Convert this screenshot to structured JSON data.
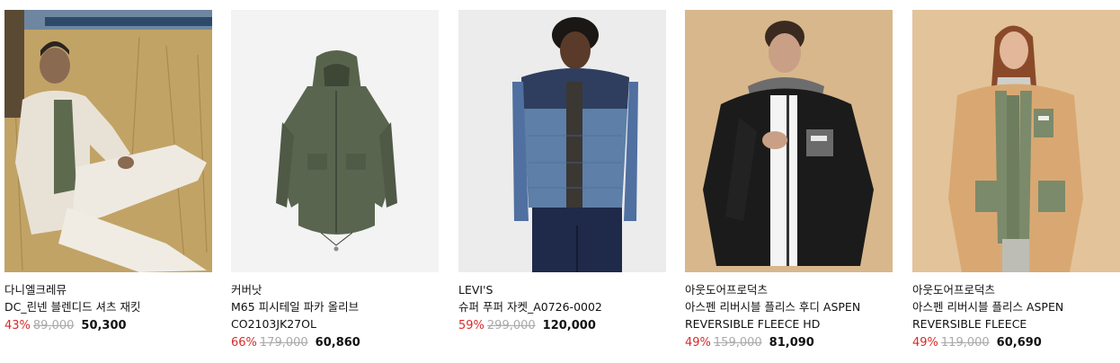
{
  "products": [
    {
      "brand": "다니엘크레뮤",
      "name_lines": [
        "DC_린넨 블렌디드 셔츠 재킷"
      ],
      "discount": "43%",
      "original_price": "89,000",
      "sale_price": "50,300",
      "bg_color": "#b99a5f"
    },
    {
      "brand": "커버낫",
      "name_lines": [
        "M65 피시테일 파카 올리브",
        "CO2103JK27OL"
      ],
      "discount": "66%",
      "original_price": "179,000",
      "sale_price": "60,860",
      "bg_color": "#f3f3f3"
    },
    {
      "brand": "LEVI'S",
      "name_lines": [
        "슈퍼 푸퍼 자켓_A0726-0002"
      ],
      "discount": "59%",
      "original_price": "299,000",
      "sale_price": "120,000",
      "bg_color": "#ececec"
    },
    {
      "brand": "아웃도어프로덕츠",
      "name_lines": [
        "아스펜 리버시블 플리스 후디 ASPEN",
        "REVERSIBLE FLEECE HD"
      ],
      "discount": "49%",
      "original_price": "159,000",
      "sale_price": "81,090",
      "bg_color": "#d9b88f"
    },
    {
      "brand": "아웃도어프로덕츠",
      "name_lines": [
        "아스펜 리버시블 플리스 ASPEN",
        "REVERSIBLE FLEECE"
      ],
      "discount": "49%",
      "original_price": "119,000",
      "sale_price": "60,690",
      "bg_color": "#e2c29a"
    }
  ],
  "colors": {
    "discount": "#d92b2b",
    "original": "#aaaaaa",
    "sale": "#111111"
  }
}
